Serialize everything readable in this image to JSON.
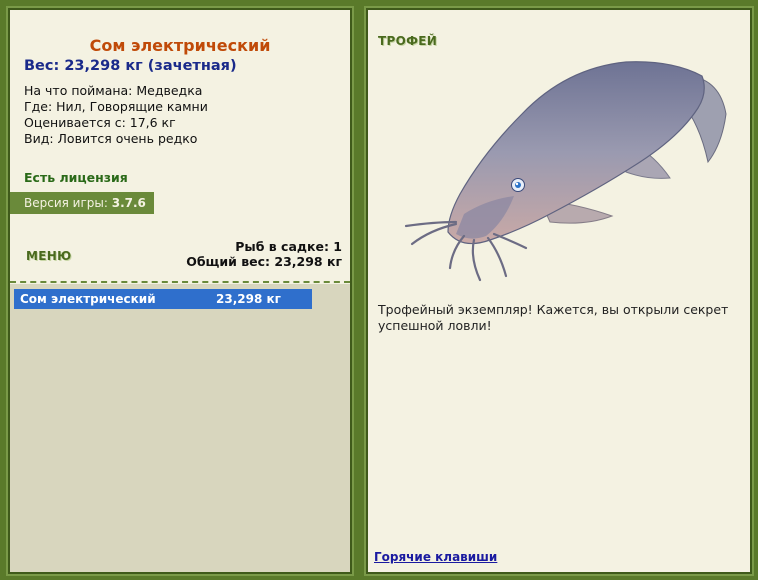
{
  "fish": {
    "name": "Сом электрический",
    "weight_line": "Вес: 23,298 кг (зачетная)",
    "bait": "На что поймана: Медведка",
    "location": "Где: Нил, Говорящие камни",
    "valuation": "Оценивается с: 17,6 кг",
    "rarity": "Вид: Ловится очень редко"
  },
  "license": "Есть лицензия",
  "version": {
    "label": "Версия игры:",
    "value": "3.7.6"
  },
  "menu_label": "МЕНЮ",
  "stats": {
    "fish_in_keepnet": "Рыб в садке: 1",
    "total_weight": "Общий вес: 23,298 кг"
  },
  "catch_list": [
    {
      "name": "Сом электрический",
      "weight": "23,298 кг"
    }
  ],
  "trophy": {
    "label": "ТРОФЕЙ",
    "description": "Трофейный экземпляр! Кажется, вы открыли секрет успешной ловли!"
  },
  "hotkeys_link": "Горячие клавиши",
  "colors": {
    "accent_green": "#4a6a1e",
    "selection_blue": "#2f6fcc",
    "title_orange": "#c04a08",
    "weight_blue": "#1a2a8a"
  }
}
